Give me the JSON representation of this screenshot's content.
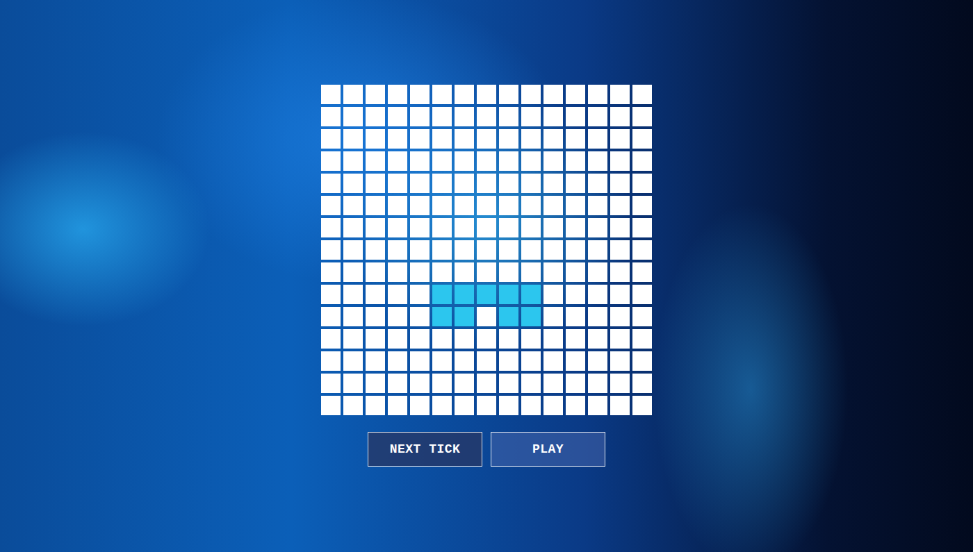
{
  "board": {
    "rows": [
      [
        false,
        false,
        false,
        false,
        false,
        false,
        false,
        false,
        false,
        false,
        false,
        false,
        false,
        false,
        false
      ],
      [
        false,
        false,
        false,
        false,
        false,
        false,
        false,
        false,
        false,
        false,
        false,
        false,
        false,
        false,
        false
      ],
      [
        false,
        false,
        false,
        false,
        false,
        false,
        false,
        false,
        false,
        false,
        false,
        false,
        false,
        false,
        false
      ],
      [
        false,
        false,
        false,
        false,
        false,
        false,
        false,
        false,
        false,
        false,
        false,
        false,
        false,
        false,
        false
      ],
      [
        false,
        false,
        false,
        false,
        false,
        false,
        false,
        false,
        false,
        false,
        false,
        false,
        false,
        false,
        false
      ],
      [
        false,
        false,
        false,
        false,
        false,
        false,
        false,
        false,
        false,
        false,
        false,
        false,
        false,
        false,
        false
      ],
      [
        false,
        false,
        false,
        false,
        false,
        false,
        false,
        false,
        false,
        false,
        false,
        false,
        false,
        false,
        false
      ],
      [
        false,
        false,
        false,
        false,
        false,
        false,
        false,
        false,
        false,
        false,
        false,
        false,
        false,
        false,
        false
      ],
      [
        false,
        false,
        false,
        false,
        false,
        false,
        false,
        false,
        false,
        false,
        false,
        false,
        false,
        false,
        false
      ],
      [
        false,
        false,
        false,
        false,
        false,
        true,
        true,
        true,
        true,
        true,
        false,
        false,
        false,
        false,
        false
      ],
      [
        false,
        false,
        false,
        false,
        false,
        true,
        true,
        false,
        true,
        true,
        false,
        false,
        false,
        false,
        false
      ],
      [
        false,
        false,
        false,
        false,
        false,
        false,
        false,
        false,
        false,
        false,
        false,
        false,
        false,
        false,
        false
      ],
      [
        false,
        false,
        false,
        false,
        false,
        false,
        false,
        false,
        false,
        false,
        false,
        false,
        false,
        false,
        false
      ],
      [
        false,
        false,
        false,
        false,
        false,
        false,
        false,
        false,
        false,
        false,
        false,
        false,
        false,
        false,
        false
      ],
      [
        false,
        false,
        false,
        false,
        false,
        false,
        false,
        false,
        false,
        false,
        false,
        false,
        false,
        false,
        false
      ]
    ]
  },
  "buttons": [
    {
      "label": "NEXT TICK"
    },
    {
      "label": "PLAY"
    }
  ]
}
